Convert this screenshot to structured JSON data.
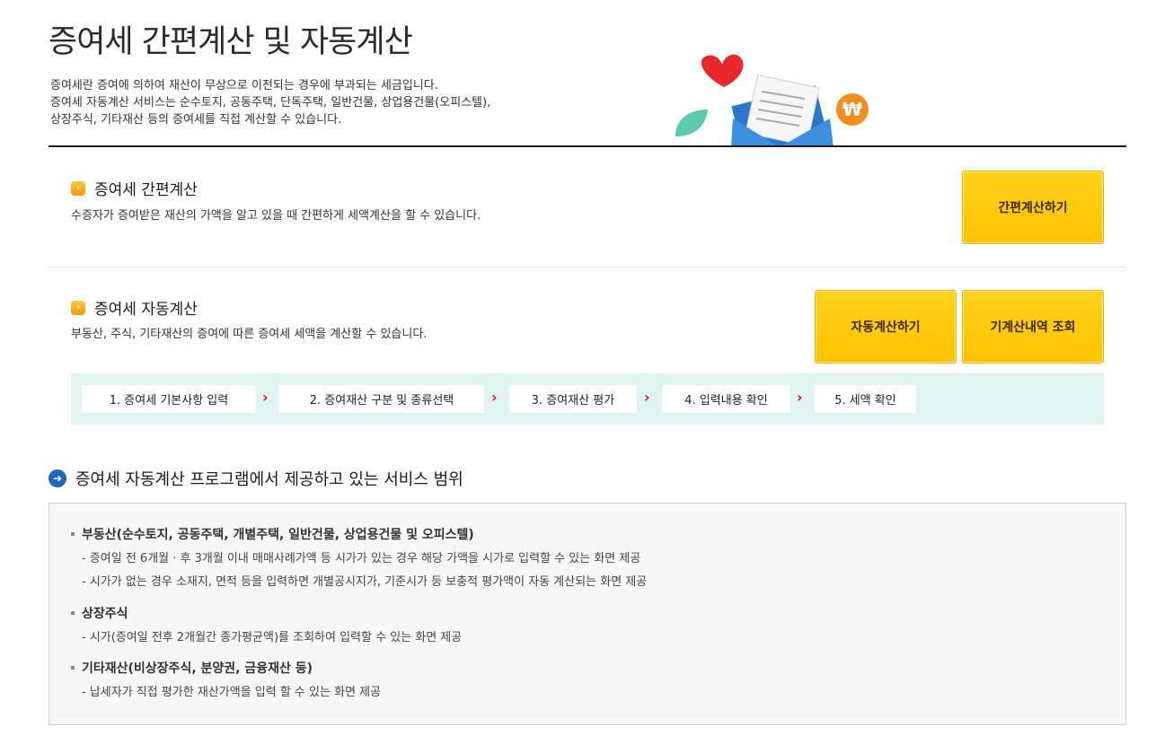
{
  "header": {
    "title": "증여세 간편계산 및 자동계산",
    "description_lines": [
      "증여세란 증여에 의하여 재산이 무상으로 이전되는 경우에 부과되는 세금입니다.",
      "증여세 자동계산 서비스는 순수토지, 공동주택, 단독주택, 일반건물, 상업용건물(오피스텔),",
      "상장주식, 기타재산 등의 증여세를 직접 계산할 수 있습니다."
    ],
    "illustration_icon": "heart-envelope-won-illustration",
    "won_symbol": "₩"
  },
  "simple_calc": {
    "title": "증여세 간편계산",
    "description": "수증자가 증여받은 재산의 가액을 알고 있을 때 간편하게 세액계산을 할 수 있습니다.",
    "button_label": "간편계산하기"
  },
  "auto_calc": {
    "title": "증여세 자동계산",
    "description": "부동산, 주식, 기타재산의 증여에 따른 증여세 세액을 계산할 수 있습니다.",
    "button_label": "자동계산하기",
    "history_button_label": "기계산내역 조회",
    "steps": [
      "1. 증여세 기본사항 입력",
      "2. 증여재산 구분 및 종류선택",
      "3. 증여재산 평가",
      "4. 입력내용 확인",
      "5. 세액 확인"
    ],
    "step_separator": "›"
  },
  "scope": {
    "title": "증여세 자동계산 프로그램에서 제공하고 있는 서비스 범위",
    "categories": [
      {
        "name": "부동산(순수토지, 공동주택, 개별주택, 일반건물, 상업용건물 및 오피스텔)",
        "items": [
          "- 증여일 전 6개월 · 후 3개월 이내 매매사례가액 등 시가가 있는 경우 해당 가액을 시가로 입력할 수 있는 화면 제공",
          "- 시가가 없는 경우 소재지, 면적 등을 입력하면 개별공시지가, 기준시가 등 보충적 평가액이 자동 계산되는 화면 제공"
        ]
      },
      {
        "name": "상장주식",
        "items": [
          "- 시가(증여일 전후 2개월간 종가평균액)를 조회하여 입력할 수 있는 화면 제공"
        ]
      },
      {
        "name": "기타재산(비상장주식, 분양권, 금융재산 등)",
        "items": [
          "- 납세자가 직접 평가한 재산가액을 입력 할 수 있는 화면 제공"
        ]
      }
    ]
  },
  "colors": {
    "button_yellow": "#ffc800",
    "step_bar_bg": "#dff3f1",
    "step_arrow": "#d2141b",
    "scope_icon": "#1f67b4"
  }
}
